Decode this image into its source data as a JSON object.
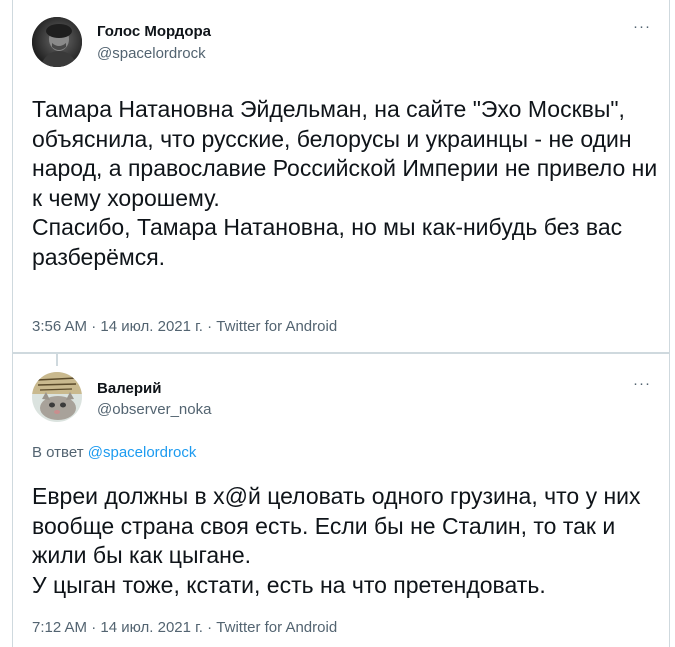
{
  "tweets": [
    {
      "display_name": "Голос Мордора",
      "handle": "@spacelordrock",
      "more_glyph": "···",
      "text": "Тамара Натановна Эйдельман, на сайте \"Эхо Москвы\", объяснила, что русские, белорусы и украинцы - не один народ, а православие Российской Империи не привело ни к чему хорошему.\nСпасибо, Тамара Натановна, но мы как-нибудь без вас разберёмся.",
      "meta": "3:56 AM · 14 июл. 2021 г. · Twitter for Android"
    },
    {
      "display_name": "Валерий",
      "handle": "@observer_noka",
      "more_glyph": "···",
      "reply_prefix": "В ответ",
      "reply_mention": "@spacelordrock",
      "text": "Евреи должны в х@й целовать одного грузина, что у них вообще страна своя есть. Если бы не Сталин, то так и жили бы как цыгане.\nУ цыган тоже, кстати, есть на что претендовать.",
      "meta": "7:12 AM · 14 июл. 2021 г. · Twitter for Android"
    }
  ],
  "colors": {
    "text": "#0f1419",
    "secondary": "#536471",
    "link": "#1d9bf0",
    "border": "#cfd9de"
  }
}
